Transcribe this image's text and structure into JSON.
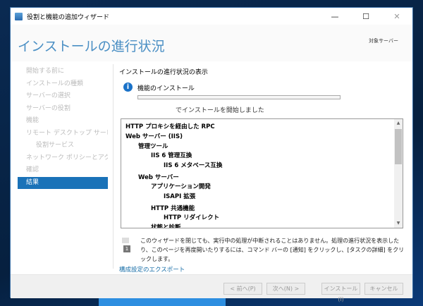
{
  "window": {
    "title": "役割と機能の追加ウィザード",
    "minimize": "—",
    "maximize": "☐",
    "close": "✕"
  },
  "header": {
    "title": "インストールの進行状況",
    "target_server": "対象サーバー"
  },
  "nav": {
    "items": [
      {
        "label": "開始する前に"
      },
      {
        "label": "インストールの種類"
      },
      {
        "label": "サーバーの選択"
      },
      {
        "label": "サーバーの役割"
      },
      {
        "label": "機能"
      },
      {
        "label": "リモート デスクトップ サービス"
      },
      {
        "label": "役割サービス"
      },
      {
        "label": "ネットワーク ポリシーとアクセ..."
      },
      {
        "label": "確認"
      },
      {
        "label": "結果"
      }
    ]
  },
  "main": {
    "section_title": "インストールの進行状況の表示",
    "info_icon": "i",
    "feature_label": "機能のインストール",
    "progress_percent": 0,
    "status": "でインストールを開始しました",
    "tree": [
      {
        "label": "HTTP プロキシを経由した RPC",
        "level": 0
      },
      {
        "label": "Web サーバー (IIS)",
        "level": 0
      },
      {
        "label": "管理ツール",
        "level": 1
      },
      {
        "label": "IIS 6 管理互換",
        "level": 2
      },
      {
        "label": "IIS 6 メタベース互換",
        "level": 3
      },
      {
        "label": "Web サーバー",
        "level": 1
      },
      {
        "label": "アプリケーション開発",
        "level": 2
      },
      {
        "label": "ISAPI 拡張",
        "level": 3
      },
      {
        "label": "HTTP 共通機能",
        "level": 2
      },
      {
        "label": "HTTP リダイレクト",
        "level": 3
      },
      {
        "label": "状態と診断",
        "level": 2
      }
    ],
    "note_icon_num": "1",
    "note": "このウィザードを閉じても、実行中の処理が中断されることはありません。処理の進行状況を表示したり、このページを再度開いたりするには、コマンド バーの [通知] をクリックし、[タスクの詳細] をクリックします。",
    "export_link": "構成設定のエクスポート"
  },
  "footer": {
    "prev": "< 前へ(P)",
    "next": "次へ(N) >",
    "install": "インストール(I)",
    "cancel": "キャンセル"
  }
}
